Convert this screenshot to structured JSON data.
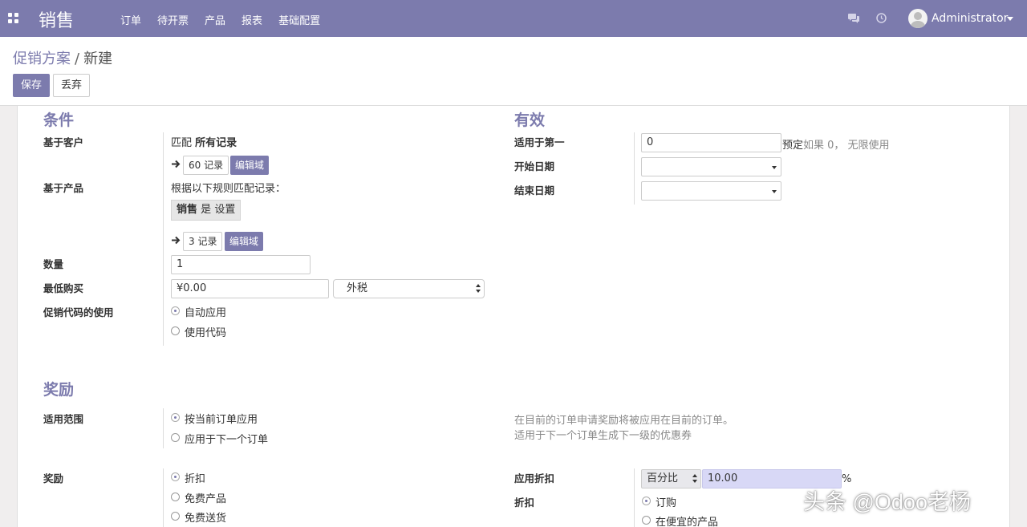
{
  "nav": {
    "brand": "销售",
    "menu": [
      "订单",
      "待开票",
      "产品",
      "报表",
      "基础配置"
    ],
    "user": "Administrator",
    "accent_color": "#7c7bad"
  },
  "breadcrumb": {
    "parent": "促销方案",
    "separator": "/",
    "current": "新建"
  },
  "actions": {
    "save": "保存",
    "discard": "丢弃"
  },
  "conditions": {
    "title": "条件",
    "customer_label": "基于客户",
    "customer_match_prefix": "匹配",
    "customer_match_value": "所有记录",
    "customer_records": "60 记录",
    "edit_domain": "编辑域",
    "product_label": "基于产品",
    "product_rule_text": "根据以下规则匹配记录：",
    "product_rule": "销售 是 设置",
    "product_rule_field": "销售",
    "product_rule_op": "是",
    "product_rule_value": "设置",
    "product_records": "3 记录",
    "quantity_label": "数量",
    "quantity_value": "1",
    "min_purchase_label": "最低购买",
    "min_purchase_value": "¥0.00",
    "tax_mode": "外税",
    "code_usage_label": "促销代码的使用",
    "code_usage_options": [
      "自动应用",
      "使用代码"
    ],
    "code_usage_selected": "自动应用"
  },
  "validity": {
    "title": "有效",
    "apply_first_label": "适用于第一",
    "apply_first_value": "0",
    "apply_first_suffix": "预定",
    "apply_first_help": "如果 0， 无限使用",
    "start_date_label": "开始日期",
    "start_date_value": "",
    "end_date_label": "结束日期",
    "end_date_value": ""
  },
  "rewards": {
    "title": "奖励",
    "scope_label": "适用范围",
    "scope_options": [
      "按当前订单应用",
      "应用于下一个订单"
    ],
    "scope_selected": "按当前订单应用",
    "scope_help_line1": "在目前的订单申请奖励将被应用在目前的订单。",
    "scope_help_line2": "适用于下一个订单生成下一级的优惠券",
    "reward_label": "奖励",
    "reward_options": [
      "折扣",
      "免费产品",
      "免费送货"
    ],
    "reward_selected": "折扣",
    "apply_discount_label": "应用折扣",
    "discount_type": "百分比",
    "discount_value": "10.00",
    "discount_unit": "%",
    "discount_label": "折扣",
    "discount_options": [
      "订购",
      "在便宜的产品"
    ],
    "discount_selected": "订购"
  },
  "watermark": "头条 @Odoo老杨"
}
